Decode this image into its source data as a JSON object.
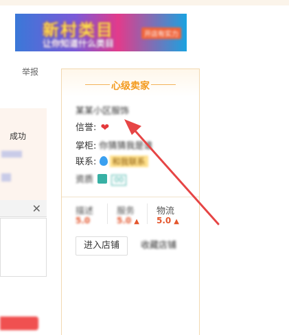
{
  "banner": {
    "title": "新村类目",
    "subtitle": "让你知道什么类目",
    "tag": "开店有实力"
  },
  "left": {
    "top_label": "举报",
    "lines": [
      "",
      "成功",
      "",
      ""
    ],
    "close_icon": "close-icon"
  },
  "seller_card": {
    "title": "心级卖家",
    "shop_name": "某某小区服饰",
    "credit_label": "信誉:",
    "credit_icon": "heart-icon",
    "manager_label": "掌柜:",
    "manager_value": "你猜猜我是谁",
    "contact_label": "联系:",
    "contact_icon": "drop-icon",
    "contact_tag": "和我联系",
    "cert_text": "资质",
    "cert_number": "00",
    "ratings": [
      {
        "label": "描述",
        "value": "5.0"
      },
      {
        "label": "服务",
        "value": "5.0"
      },
      {
        "label": "物流",
        "value": "5.0"
      }
    ],
    "enter_shop_label": "进入店铺",
    "favorite_shop_label": "收藏店铺"
  },
  "colors": {
    "title_orange": "#f39a1e",
    "rating_red": "#e4572e",
    "arrow_red": "#e64545",
    "card_border": "#f1d8b0"
  }
}
